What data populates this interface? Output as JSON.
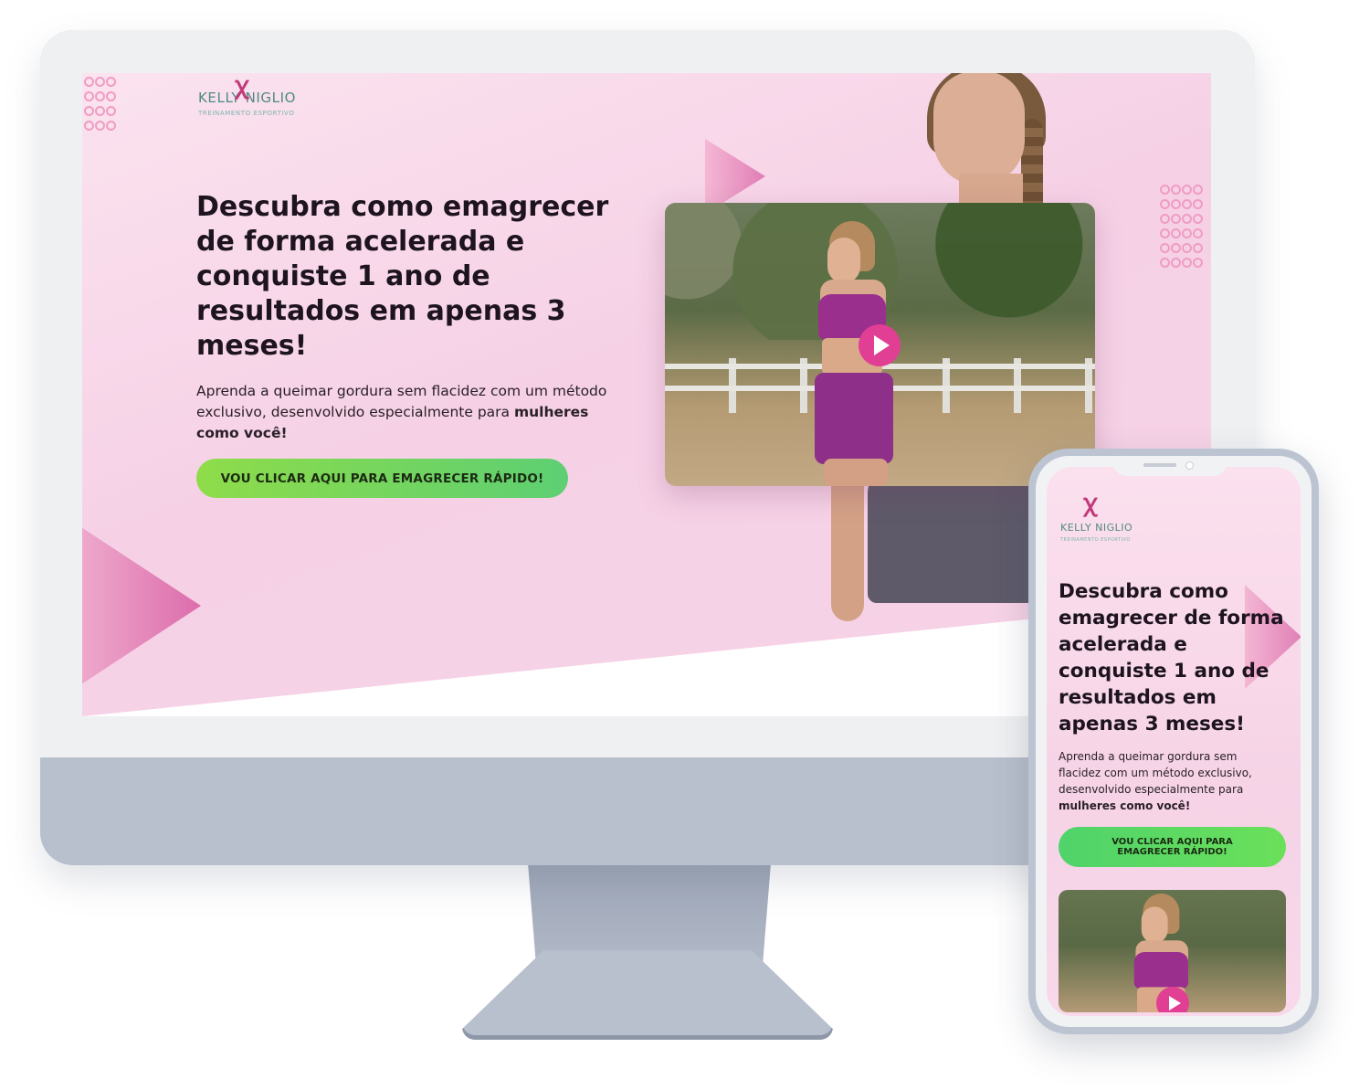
{
  "brand": {
    "name": "KELLY NIGLIO",
    "tagline": "TREINAMENTO ESPORTIVO",
    "logo_mark": "ꭓ",
    "accent_color": "#c13a79",
    "teal_color": "#4e8a83"
  },
  "desktop": {
    "headline": "Descubra como emagrecer de forma acelerada e conquiste 1 ano de resultados em apenas 3 meses!",
    "description_prefix": "Aprenda a queimar gordura sem flacidez com um método exclusivo, desenvolvido especialmente para ",
    "description_bold": "mulheres como você!",
    "cta_label": "VOU CLICAR AQUI PARA EMAGRECER RÁPIDO!",
    "video": {
      "play_icon": "play-icon"
    }
  },
  "mobile": {
    "headline": "Descubra como emagrecer de forma acelerada e conquiste 1 ano de resultados em apenas 3 meses!",
    "description_prefix": "Aprenda a queimar gordura sem flacidez com um método exclusivo, desenvolvido especialmente para ",
    "description_bold": "mulheres como você!",
    "cta_label": "VOU CLICAR AQUI PARA EMAGRECER RÁPIDO!"
  },
  "colors": {
    "hero_pink": "#f6d1e6",
    "cta_green": "#6dd460",
    "play_pink": "#e13f93",
    "device_gray": "#b8bfcd"
  }
}
